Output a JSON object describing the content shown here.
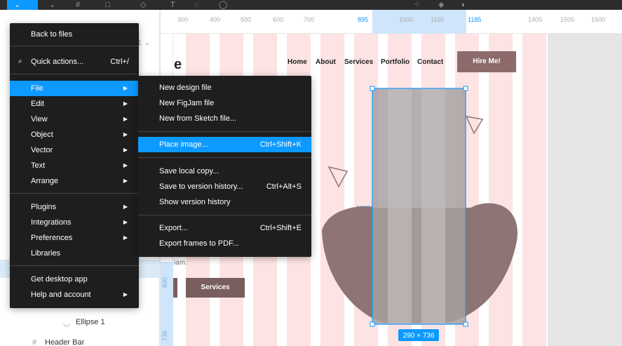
{
  "toolbar": {
    "icons": [
      "figma-menu-icon",
      "move-icon",
      "frame-icon",
      "shape-icon",
      "pen-icon",
      "text-icon",
      "hand-icon",
      "comment-icon",
      "component-icon",
      "mask-icon",
      "contrast-icon"
    ]
  },
  "main_menu": {
    "back": "Back to files",
    "quick_actions": "Quick actions...",
    "quick_actions_shortcut": "Ctrl+/",
    "items": [
      "File",
      "Edit",
      "View",
      "Object",
      "Vector",
      "Text",
      "Arrange"
    ],
    "items2": [
      "Plugins",
      "Integrations",
      "Preferences",
      "Libraries"
    ],
    "desktop": "Get desktop app",
    "help": "Help and account"
  },
  "file_menu": {
    "new_design": "New design file",
    "new_figjam": "New FigJam file",
    "new_sketch": "New from Sketch file...",
    "place_image": "Place image...",
    "place_image_shortcut": "Ctrl+Shift+K",
    "save_local": "Save local copy...",
    "save_version": "Save to version history...",
    "save_version_shortcut": "Ctrl+Alt+S",
    "show_version": "Show version history",
    "export": "Export...",
    "export_shortcut": "Ctrl+Shift+E",
    "export_pdf": "Export frames to PDF..."
  },
  "layers": {
    "ellipse": "Ellipse 1",
    "header_bar": "Header Bar"
  },
  "ruler": {
    "ticks": [
      "300",
      "400",
      "500",
      "600",
      "700",
      "895",
      "1000",
      "1100",
      "1185",
      "1400",
      "1500",
      "1600"
    ],
    "left_ticks": [
      "600",
      "736"
    ]
  },
  "canvas": {
    "logo": "e",
    "nav": [
      "Home",
      "About",
      "Services",
      "Portfolio",
      "Contact"
    ],
    "hire_button": "Hire Me!",
    "services_button": "Services",
    "small_text": "iam.",
    "size_badge": "290 × 736"
  },
  "colors": {
    "accent": "#0d99ff",
    "menu_bg": "#1e1e1e",
    "column": "#fde3e3",
    "brown": "#7a5d5d"
  }
}
